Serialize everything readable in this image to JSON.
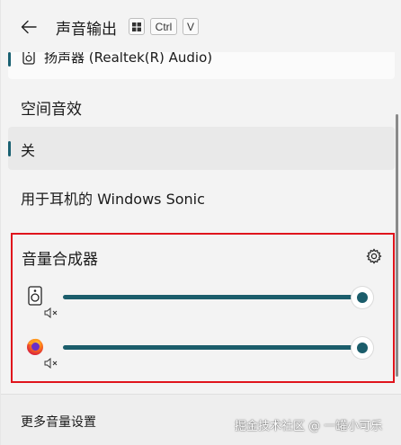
{
  "header": {
    "title": "声音输出",
    "shortcut_keys": [
      "Win",
      "Ctrl",
      "V"
    ]
  },
  "device": {
    "label": "扬声器 (Realtek(R) Audio)",
    "icon": "speaker-icon"
  },
  "spatial": {
    "title": "空间音效",
    "options": [
      {
        "label": "关",
        "selected": true
      },
      {
        "label": "用于耳机的 Windows Sonic",
        "selected": false
      }
    ]
  },
  "mixer": {
    "title": "音量合成器",
    "settings_icon": "gear-icon",
    "apps": [
      {
        "name": "speaker-device",
        "icon": "speaker-icon",
        "volume": 1.0
      },
      {
        "name": "firefox",
        "icon": "firefox-icon",
        "volume": 1.0
      }
    ]
  },
  "footer": {
    "more_settings": "更多音量设置",
    "watermark": "掘金技术社区 @ 一罐小可乐"
  },
  "colors": {
    "accent": "#1b5d6b",
    "highlight_border": "#e0141c"
  }
}
